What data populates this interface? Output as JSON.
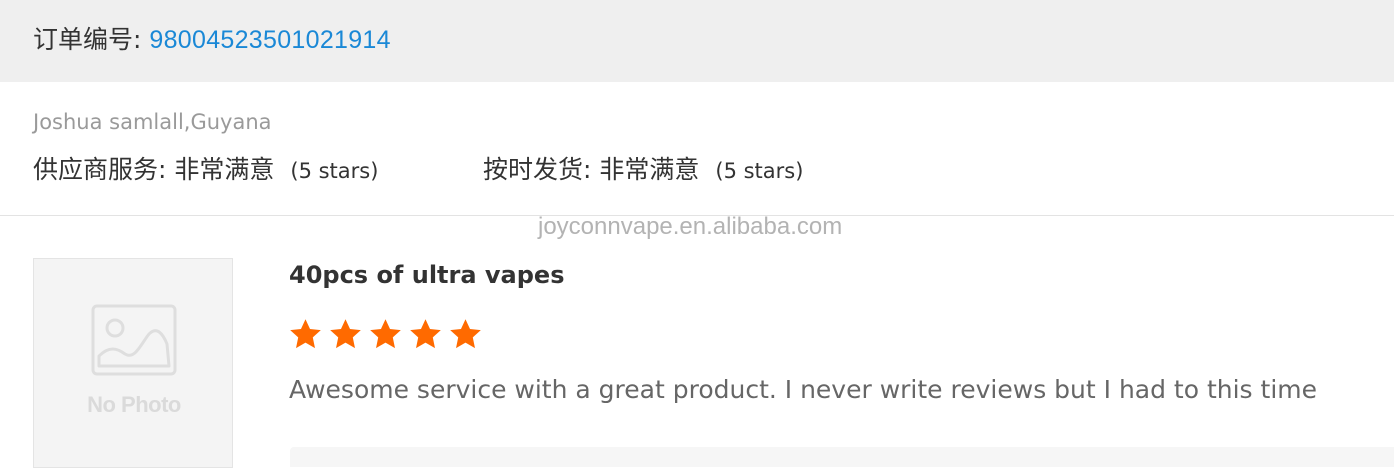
{
  "order": {
    "label": "订单编号: ",
    "number": "98004523501021914"
  },
  "buyer": {
    "name_country": "Joshua samlall,Guyana"
  },
  "ratings": [
    {
      "label": "供应商服务: ",
      "value": "非常满意",
      "stars_text": "(5 stars)"
    },
    {
      "label": "按时发货: ",
      "value": "非常满意",
      "stars_text": "(5 stars)"
    }
  ],
  "watermark": "joyconnvape.en.alibaba.com",
  "product": {
    "photo_placeholder_text": "No Photo",
    "photo_icon": "image-placeholder-icon",
    "title": "40pcs of ultra vapes",
    "rating": 5,
    "rating_max": 5,
    "star_color": "#ff6a00",
    "review": "Awesome service with a great product. I never write reviews but I had to this time"
  },
  "colors": {
    "order_number": "#1a88d6",
    "header_bg": "#efefef"
  }
}
